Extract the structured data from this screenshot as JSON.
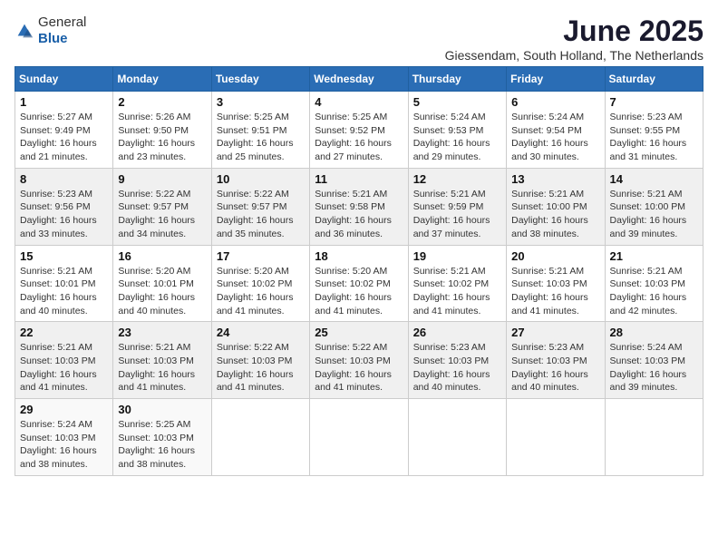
{
  "logo": {
    "text_general": "General",
    "text_blue": "Blue",
    "arrow_color": "#2a6db5"
  },
  "title": "June 2025",
  "location": "Giessendam, South Holland, The Netherlands",
  "days_of_week": [
    "Sunday",
    "Monday",
    "Tuesday",
    "Wednesday",
    "Thursday",
    "Friday",
    "Saturday"
  ],
  "weeks": [
    [
      {
        "day": 1,
        "sunrise": "5:27 AM",
        "sunset": "9:49 PM",
        "daylight": "16 hours and 21 minutes."
      },
      {
        "day": 2,
        "sunrise": "5:26 AM",
        "sunset": "9:50 PM",
        "daylight": "16 hours and 23 minutes."
      },
      {
        "day": 3,
        "sunrise": "5:25 AM",
        "sunset": "9:51 PM",
        "daylight": "16 hours and 25 minutes."
      },
      {
        "day": 4,
        "sunrise": "5:25 AM",
        "sunset": "9:52 PM",
        "daylight": "16 hours and 27 minutes."
      },
      {
        "day": 5,
        "sunrise": "5:24 AM",
        "sunset": "9:53 PM",
        "daylight": "16 hours and 29 minutes."
      },
      {
        "day": 6,
        "sunrise": "5:24 AM",
        "sunset": "9:54 PM",
        "daylight": "16 hours and 30 minutes."
      },
      {
        "day": 7,
        "sunrise": "5:23 AM",
        "sunset": "9:55 PM",
        "daylight": "16 hours and 31 minutes."
      }
    ],
    [
      {
        "day": 8,
        "sunrise": "5:23 AM",
        "sunset": "9:56 PM",
        "daylight": "16 hours and 33 minutes."
      },
      {
        "day": 9,
        "sunrise": "5:22 AM",
        "sunset": "9:57 PM",
        "daylight": "16 hours and 34 minutes."
      },
      {
        "day": 10,
        "sunrise": "5:22 AM",
        "sunset": "9:57 PM",
        "daylight": "16 hours and 35 minutes."
      },
      {
        "day": 11,
        "sunrise": "5:21 AM",
        "sunset": "9:58 PM",
        "daylight": "16 hours and 36 minutes."
      },
      {
        "day": 12,
        "sunrise": "5:21 AM",
        "sunset": "9:59 PM",
        "daylight": "16 hours and 37 minutes."
      },
      {
        "day": 13,
        "sunrise": "5:21 AM",
        "sunset": "10:00 PM",
        "daylight": "16 hours and 38 minutes."
      },
      {
        "day": 14,
        "sunrise": "5:21 AM",
        "sunset": "10:00 PM",
        "daylight": "16 hours and 39 minutes."
      }
    ],
    [
      {
        "day": 15,
        "sunrise": "5:21 AM",
        "sunset": "10:01 PM",
        "daylight": "16 hours and 40 minutes."
      },
      {
        "day": 16,
        "sunrise": "5:20 AM",
        "sunset": "10:01 PM",
        "daylight": "16 hours and 40 minutes."
      },
      {
        "day": 17,
        "sunrise": "5:20 AM",
        "sunset": "10:02 PM",
        "daylight": "16 hours and 41 minutes."
      },
      {
        "day": 18,
        "sunrise": "5:20 AM",
        "sunset": "10:02 PM",
        "daylight": "16 hours and 41 minutes."
      },
      {
        "day": 19,
        "sunrise": "5:21 AM",
        "sunset": "10:02 PM",
        "daylight": "16 hours and 41 minutes."
      },
      {
        "day": 20,
        "sunrise": "5:21 AM",
        "sunset": "10:03 PM",
        "daylight": "16 hours and 41 minutes."
      },
      {
        "day": 21,
        "sunrise": "5:21 AM",
        "sunset": "10:03 PM",
        "daylight": "16 hours and 42 minutes."
      }
    ],
    [
      {
        "day": 22,
        "sunrise": "5:21 AM",
        "sunset": "10:03 PM",
        "daylight": "16 hours and 41 minutes."
      },
      {
        "day": 23,
        "sunrise": "5:21 AM",
        "sunset": "10:03 PM",
        "daylight": "16 hours and 41 minutes."
      },
      {
        "day": 24,
        "sunrise": "5:22 AM",
        "sunset": "10:03 PM",
        "daylight": "16 hours and 41 minutes."
      },
      {
        "day": 25,
        "sunrise": "5:22 AM",
        "sunset": "10:03 PM",
        "daylight": "16 hours and 41 minutes."
      },
      {
        "day": 26,
        "sunrise": "5:23 AM",
        "sunset": "10:03 PM",
        "daylight": "16 hours and 40 minutes."
      },
      {
        "day": 27,
        "sunrise": "5:23 AM",
        "sunset": "10:03 PM",
        "daylight": "16 hours and 40 minutes."
      },
      {
        "day": 28,
        "sunrise": "5:24 AM",
        "sunset": "10:03 PM",
        "daylight": "16 hours and 39 minutes."
      }
    ],
    [
      {
        "day": 29,
        "sunrise": "5:24 AM",
        "sunset": "10:03 PM",
        "daylight": "16 hours and 38 minutes."
      },
      {
        "day": 30,
        "sunrise": "5:25 AM",
        "sunset": "10:03 PM",
        "daylight": "16 hours and 38 minutes."
      },
      null,
      null,
      null,
      null,
      null
    ]
  ]
}
